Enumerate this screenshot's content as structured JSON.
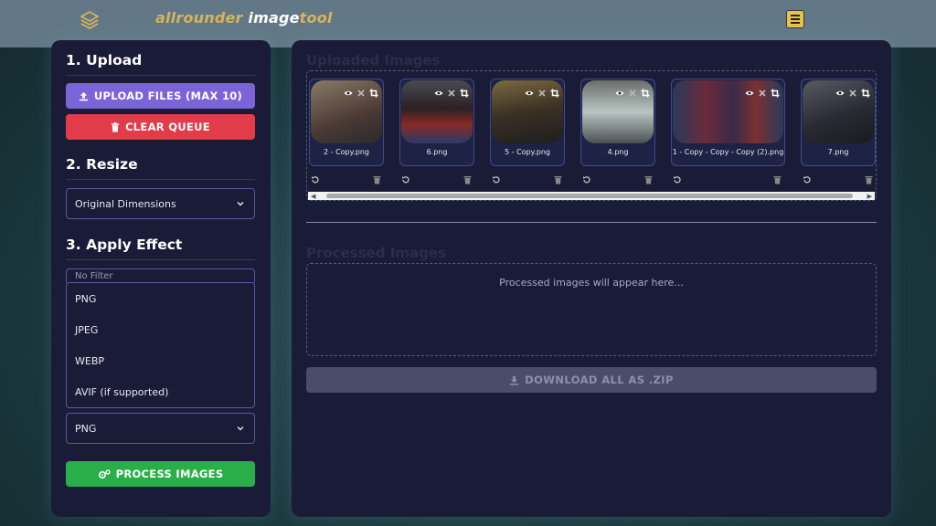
{
  "header": {
    "brand_part1": "allrounder ",
    "brand_part2": "image",
    "brand_part3": "tool",
    "logo_icon": "layers-icon",
    "menu_icon": "hamburger-menu-icon",
    "colors": {
      "bar": "#627886",
      "brand_gold": "#d8b35a",
      "menu_bg": "#e6c34a"
    }
  },
  "sidebar": {
    "upload_title": "1. Upload",
    "upload_button": "UPLOAD FILES (MAX 10)",
    "clear_button": "CLEAR QUEUE",
    "resize_title": "2. Resize",
    "resize_selected": "Original Dimensions",
    "effect_title": "3. Apply Effect",
    "effect_selected": "No Filter",
    "format_options": [
      "PNG",
      "JPEG",
      "WEBP",
      "AVIF (if supported)"
    ],
    "format_selected": "PNG",
    "process_button": "PROCESS IMAGES",
    "colors": {
      "upload": "#7b63d8",
      "clear": "#e23b4a",
      "process": "#2aae4a"
    }
  },
  "main": {
    "uploaded_title": "Uploaded Images",
    "processed_title": "Processed Images",
    "images": [
      {
        "name": "2 - Copy.png",
        "color": "#6a5a4c"
      },
      {
        "name": "6.png",
        "color": "#3a2a2a"
      },
      {
        "name": "5 - Copy.png",
        "color": "#5a4a30"
      },
      {
        "name": "4.png",
        "color": "#8a9a98"
      },
      {
        "name": "1 - Copy - Copy - Copy (2).png",
        "color": "#5a3a4a"
      },
      {
        "name": "7.png",
        "color": "#3a3a46"
      }
    ],
    "processed_placeholder": "Processed images will appear here...",
    "download_button": "DOWNLOAD ALL AS .ZIP"
  }
}
